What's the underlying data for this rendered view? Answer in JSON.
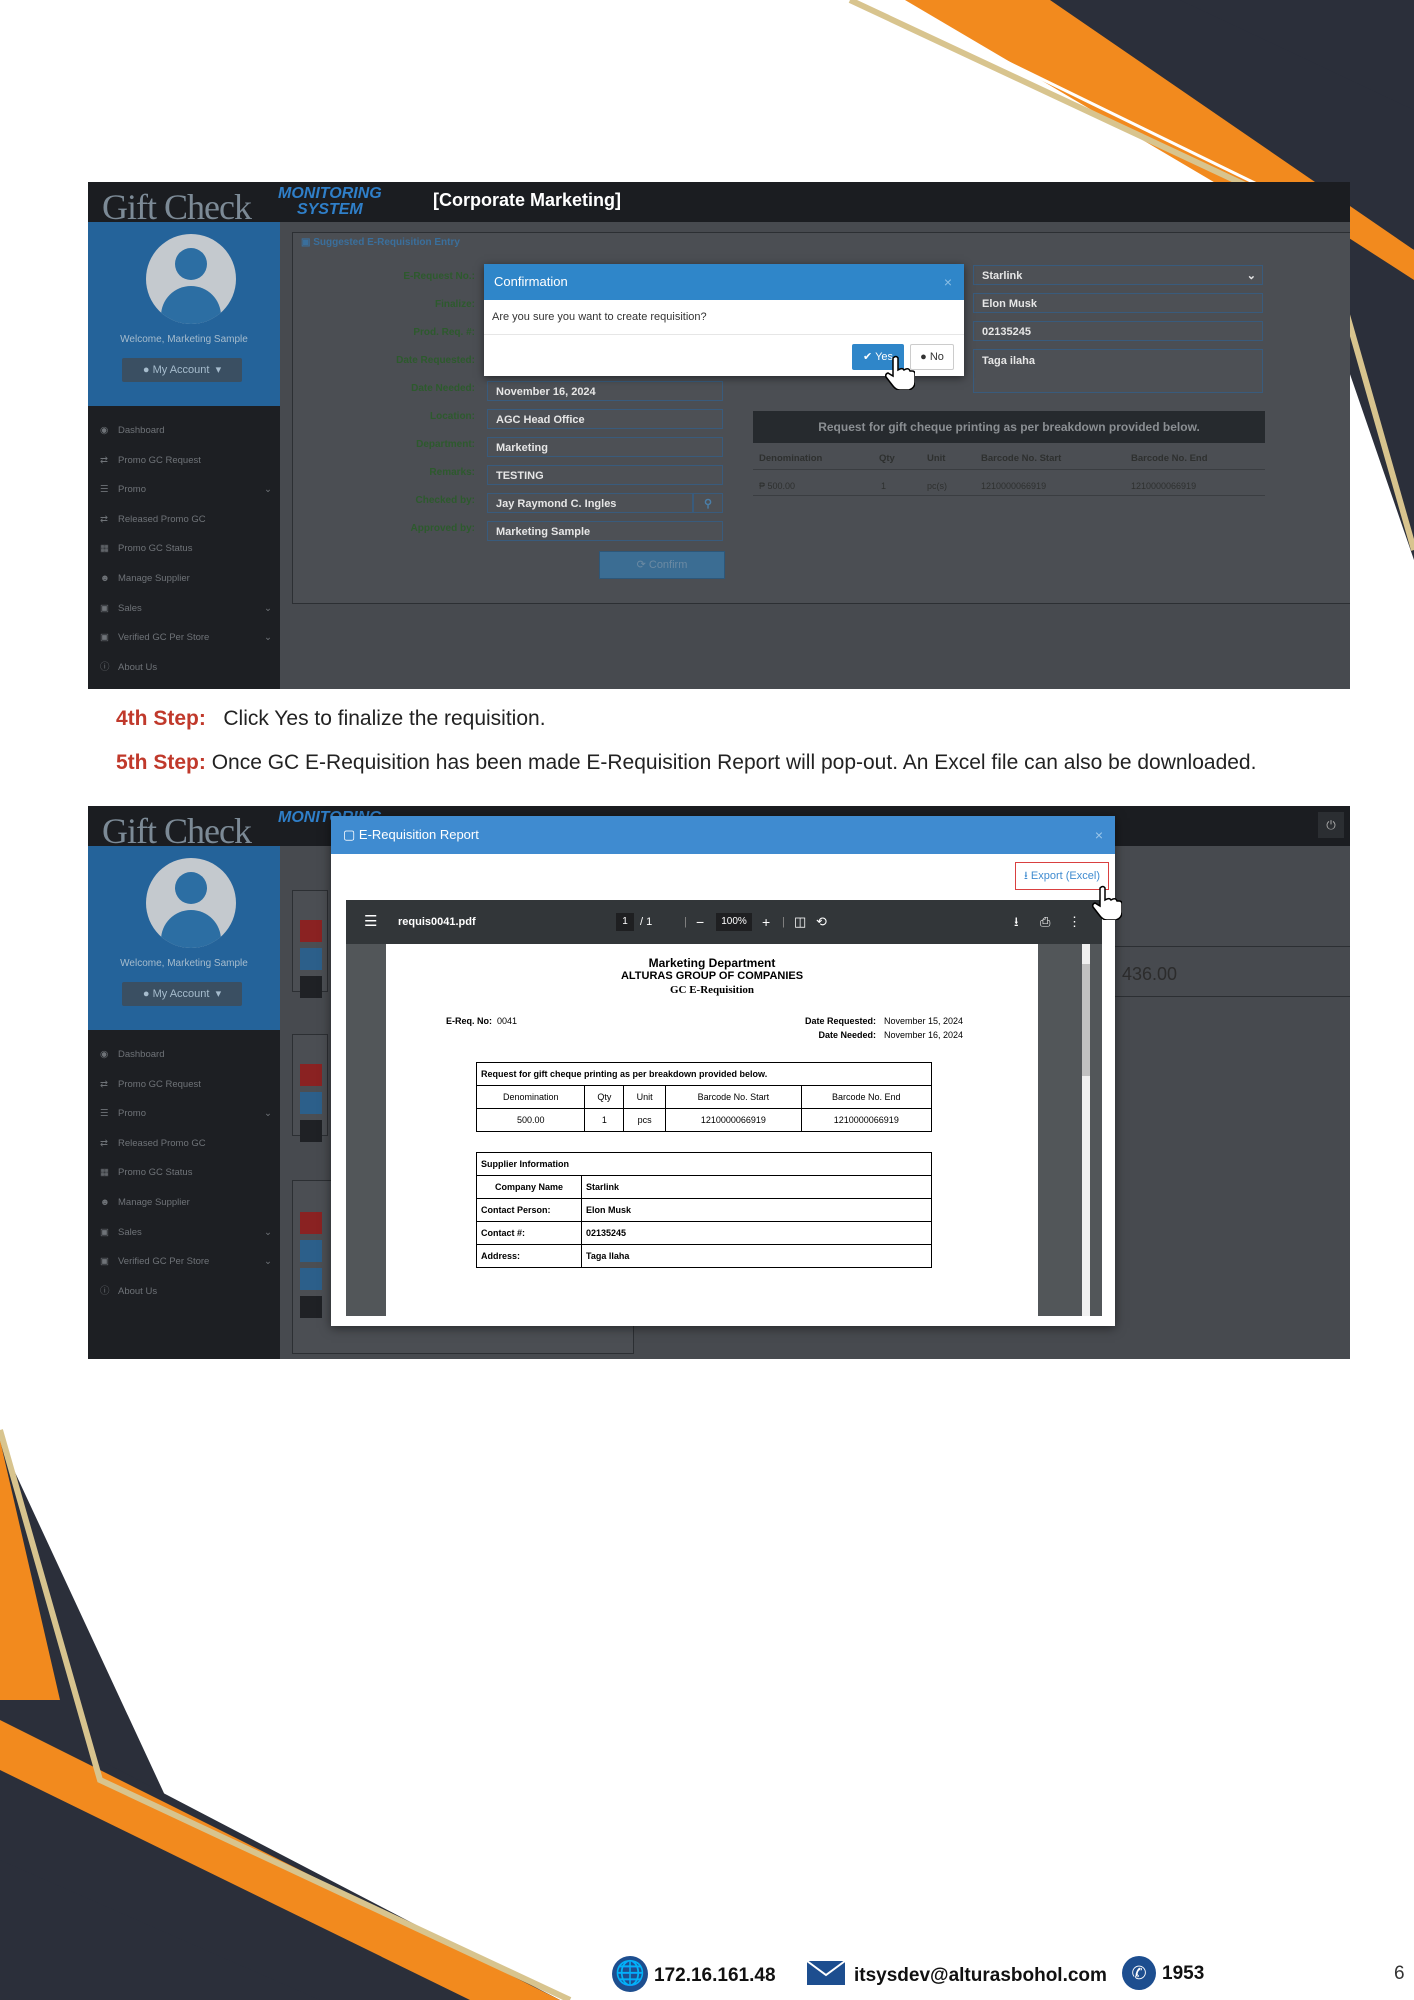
{
  "shot1": {
    "logo": {
      "gift": "Gift Check",
      "monitoring": "MONITORING",
      "system": "SYSTEM"
    },
    "header_title": "[Corporate Marketing]",
    "sidebar": {
      "welcome": "Welcome, Marketing Sample",
      "my_account": "My Account",
      "items": [
        {
          "label": "Dashboard",
          "icon": "dashboard-icon"
        },
        {
          "label": "Promo GC Request",
          "icon": "shuffle-icon"
        },
        {
          "label": "Promo",
          "icon": "list-icon"
        },
        {
          "label": "Released Promo GC",
          "icon": "shuffle-icon"
        },
        {
          "label": "Promo GC Status",
          "icon": "grid-icon"
        },
        {
          "label": "Manage Supplier",
          "icon": "users-icon"
        },
        {
          "label": "Sales",
          "icon": "monitor-icon"
        },
        {
          "label": "Verified GC Per Store",
          "icon": "monitor-icon"
        },
        {
          "label": "About Us",
          "icon": "info-icon"
        }
      ]
    },
    "panel_title": "Suggested E-Requisition Entry",
    "form": {
      "labels": {
        "ereq": "E-Request No.:",
        "finalize": "Finalize:",
        "prodreq": "Prod. Req. #:",
        "date_requested": "Date Requested:",
        "date_needed": "Date Needed:",
        "location": "Location:",
        "department": "Department:",
        "remarks": "Remarks:",
        "checked_by": "Checked by:",
        "approved_by": "Approved by:"
      },
      "values": {
        "date_needed": "November 16, 2024",
        "location": "AGC Head Office",
        "department": "Marketing",
        "remarks": "TESTING",
        "checked_by": "Jay Raymond C. Ingles",
        "approved_by": "Marketing Sample"
      },
      "confirm_button": "Confirm"
    },
    "supplier": {
      "company": "Starlink",
      "contact_person": "Elon Musk",
      "contact_no": "02135245",
      "address": "Taga ilaha"
    },
    "request_table": {
      "header": "Request for gift cheque printing as per breakdown provided below.",
      "columns": [
        "Denomination",
        "Qty",
        "Unit",
        "Barcode No. Start",
        "Barcode No. End"
      ],
      "row": [
        "₱ 500.00",
        "1",
        "pc(s)",
        "1210000066919",
        "1210000066919"
      ]
    },
    "modal": {
      "title": "Confirmation",
      "close": "×",
      "message": "Are you sure you want to create requisition?",
      "yes": "Yes",
      "no": "No"
    }
  },
  "step4": {
    "label": "4th Step:",
    "text": "Click Yes to finalize the requisition."
  },
  "step5": {
    "label": "5th Step:",
    "text": "Once GC E-Requisition has been made E-Requisition Report will pop-out. An Excel file can also be downloaded."
  },
  "shot2": {
    "modal_title": "E-Requisition Report",
    "close": "×",
    "export": "Export (Excel)",
    "bg_amount": "436.00",
    "pdf": {
      "filename": "requis0041.pdf",
      "page_current": "1",
      "page_total": "/ 1",
      "zoom": "100%",
      "dept": "Marketing Department",
      "company": "ALTURAS GROUP OF COMPANIES",
      "doc_title": "GC E-Requisition",
      "ereq_label": "E-Req. No:",
      "ereq_value": "0041",
      "date_requested_label": "Date Requested:",
      "date_requested_value": "November 15, 2024",
      "date_needed_label": "Date Needed:",
      "date_needed_value": "November 16, 2024",
      "table_title": "Request for gift cheque printing as per breakdown provided below.",
      "columns": [
        "Denomination",
        "Qty",
        "Unit",
        "Barcode No. Start",
        "Barcode No. End"
      ],
      "row": [
        "500.00",
        "1",
        "pcs",
        "1210000066919",
        "1210000066919"
      ],
      "supplier_title": "Supplier Information",
      "supplier_rows": [
        [
          "Company Name",
          "Starlink"
        ],
        [
          "Contact Person:",
          "Elon Musk"
        ],
        [
          "Contact #:",
          "02135245"
        ],
        [
          "Address:",
          "Taga Ilaha"
        ]
      ]
    }
  },
  "footer": {
    "ip": "172.16.161.48",
    "email": "itsysdev@alturasbohol.com",
    "phone": "1953",
    "page_number": "6"
  }
}
